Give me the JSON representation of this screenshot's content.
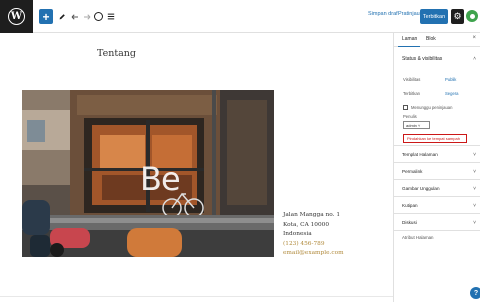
{
  "toolbar": {
    "logo_letter": "W",
    "add_symbol": "+",
    "save_draft_label": "Simpan draf",
    "preview_label": "Pratinjau",
    "publish_label": "Terbitkan"
  },
  "canvas": {
    "page_title": "Tentang",
    "cover_text": "Be",
    "address_lines": [
      "Jalan Mangga no. 1",
      "Kota, CA 10000",
      "Indonesia"
    ],
    "phone": "(123) 456-789",
    "email": "email@example.com"
  },
  "sidebar": {
    "tabs": [
      "Laman",
      "Blok"
    ],
    "status_heading": "Status & visibilitas",
    "visibility_label": "Visibilitas",
    "visibility_value": "Publik",
    "publish_label": "Terbitkan",
    "publish_value": "Segera",
    "pending_label": "Menunggu peninjauan",
    "author_label": "Penulis",
    "author_value": "admin",
    "trash_label": "Pindahkan ke tempat sampah",
    "panels": [
      "Templat Halaman",
      "Permalink",
      "Gambar Unggulan",
      "Kutipan",
      "Diskusi"
    ],
    "page_attributes": "Atribut Halaman"
  },
  "colors": {
    "accent": "#2271b1",
    "dark": "#1e1e1e",
    "danger": "#cc1818",
    "link_gold": "#b0893a",
    "jetpack": "#3fa34d"
  }
}
